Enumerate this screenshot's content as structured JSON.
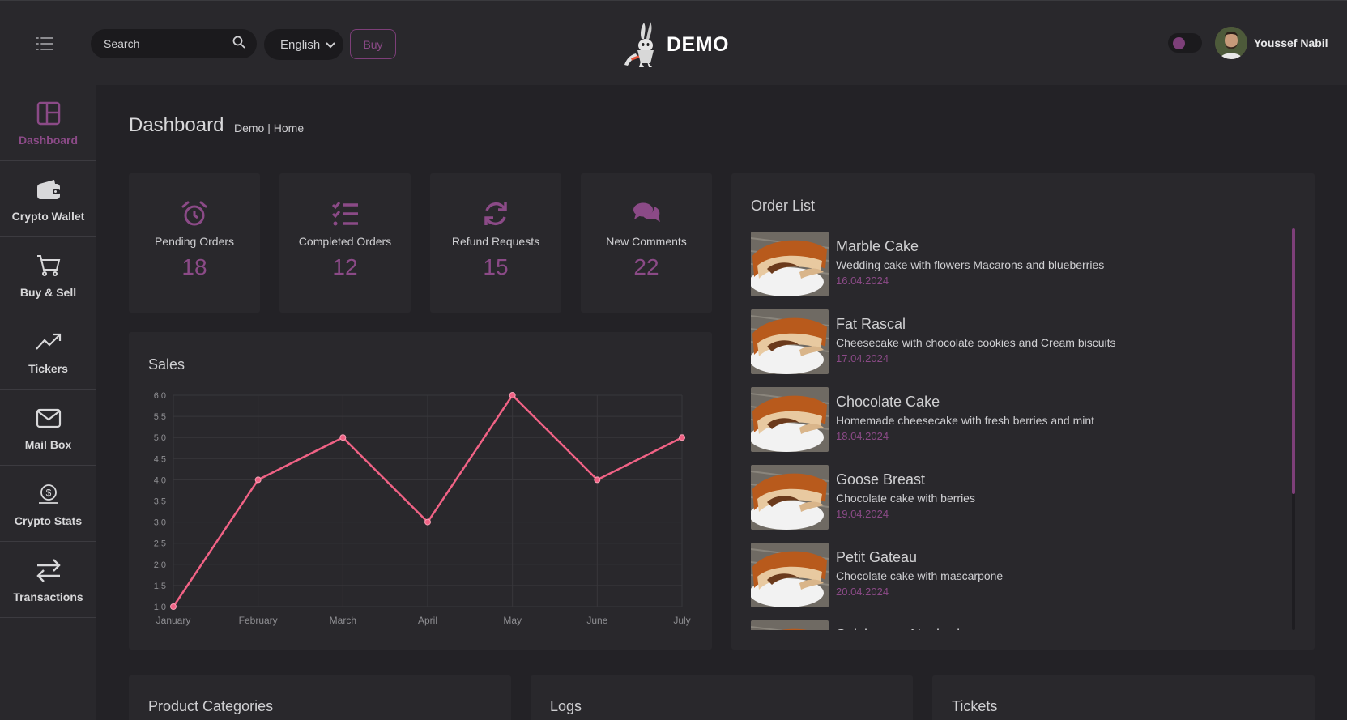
{
  "header": {
    "search_placeholder": "Search",
    "language": "English",
    "buy_label": "Buy",
    "logo_text": "DEMO",
    "user_name": "Youssef Nabil"
  },
  "sidebar": {
    "items": [
      {
        "label": "Dashboard",
        "icon": "layout-icon",
        "active": true
      },
      {
        "label": "Crypto Wallet",
        "icon": "wallet-icon"
      },
      {
        "label": "Buy & Sell",
        "icon": "cart-icon"
      },
      {
        "label": "Tickers",
        "icon": "trending-up-icon"
      },
      {
        "label": "Mail Box",
        "icon": "envelope-icon"
      },
      {
        "label": "Crypto Stats",
        "icon": "coin-icon"
      },
      {
        "label": "Transactions",
        "icon": "arrows-exchange-icon"
      }
    ]
  },
  "page": {
    "title": "Dashboard",
    "breadcrumb": "Demo | Home"
  },
  "stats": [
    {
      "label": "Pending Orders",
      "value": "18",
      "icon": "alarm-clock-icon"
    },
    {
      "label": "Completed Orders",
      "value": "12",
      "icon": "checklist-icon"
    },
    {
      "label": "Refund Requests",
      "value": "15",
      "icon": "refresh-icon"
    },
    {
      "label": "New Comments",
      "value": "22",
      "icon": "comments-icon"
    }
  ],
  "sales": {
    "title": "Sales"
  },
  "chart_data": {
    "type": "line",
    "categories": [
      "January",
      "February",
      "March",
      "April",
      "May",
      "June",
      "July"
    ],
    "series": [
      {
        "values": [
          1.0,
          4.0,
          5.0,
          3.0,
          6.0,
          4.0,
          5.0
        ],
        "color": "#f06285"
      }
    ],
    "yticks": [
      "1.0",
      "1.5",
      "2.0",
      "2.5",
      "3.0",
      "3.5",
      "4.0",
      "4.5",
      "5.0",
      "5.5",
      "6.0"
    ],
    "ylim": [
      1,
      6
    ],
    "grid": true,
    "title": "",
    "xlabel": "",
    "ylabel": ""
  },
  "orders": {
    "title": "Order List",
    "items": [
      {
        "name": "Marble Cake",
        "desc": "Wedding cake with flowers Macarons and blueberries",
        "date": "16.04.2024"
      },
      {
        "name": "Fat Rascal",
        "desc": "Cheesecake with chocolate cookies and Cream biscuits",
        "date": "17.04.2024"
      },
      {
        "name": "Chocolate Cake",
        "desc": "Homemade cheesecake with fresh berries and mint",
        "date": "18.04.2024"
      },
      {
        "name": "Goose Breast",
        "desc": "Chocolate cake with berries",
        "date": "19.04.2024"
      },
      {
        "name": "Petit Gateau",
        "desc": "Chocolate cake with mascarpone",
        "date": "20.04.2024"
      },
      {
        "name": "Salzburger Nockerl",
        "desc": "",
        "date": ""
      }
    ]
  },
  "bottom_cards": {
    "categories": "Product Categories",
    "logs": "Logs",
    "tickets": "Tickets"
  },
  "colors": {
    "accent": "#8b4a87",
    "background": "#232226",
    "card": "#29282c",
    "line": "#f06285"
  }
}
